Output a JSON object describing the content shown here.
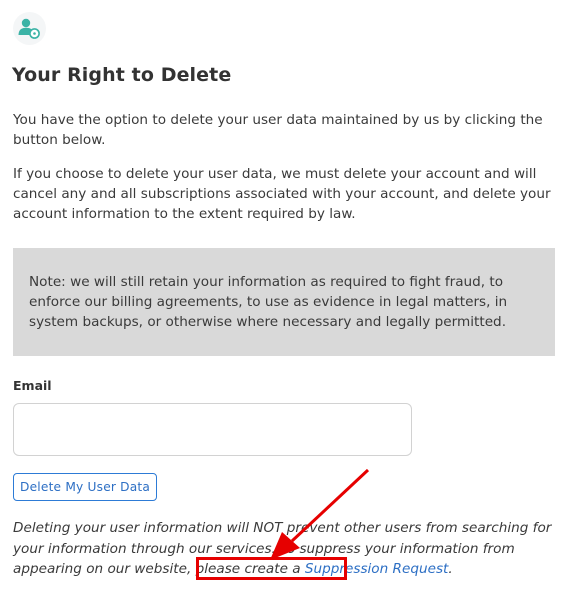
{
  "header": {
    "icon": "user-settings-icon",
    "title": "Your Right to Delete"
  },
  "content": {
    "paragraph1": "You have the option to delete your user data maintained by us by clicking the button below.",
    "paragraph2": "If you choose to delete your user data, we must delete your account and will cancel any and all subscriptions associated with your account, and delete your account information to the extent required by law.",
    "note": "Note: we will still retain your information as required to fight fraud, to enforce our billing agreements, to use as evidence in legal matters, in system backups, or otherwise where necessary and legally permitted."
  },
  "form": {
    "email_label": "Email",
    "email_value": "",
    "email_placeholder": "",
    "delete_button_label": "Delete My User Data"
  },
  "footer": {
    "text_before_link": "Deleting your user information will NOT prevent other users from searching for your information through our services. To suppress your information from appearing on our website, please create a ",
    "link_text": "Suppression Request",
    "text_after_link": "."
  },
  "colors": {
    "accent": "#2d6fc4",
    "annotation": "#e60000",
    "note_background": "#d9d9d9",
    "icon_teal": "#3bb3a6"
  }
}
